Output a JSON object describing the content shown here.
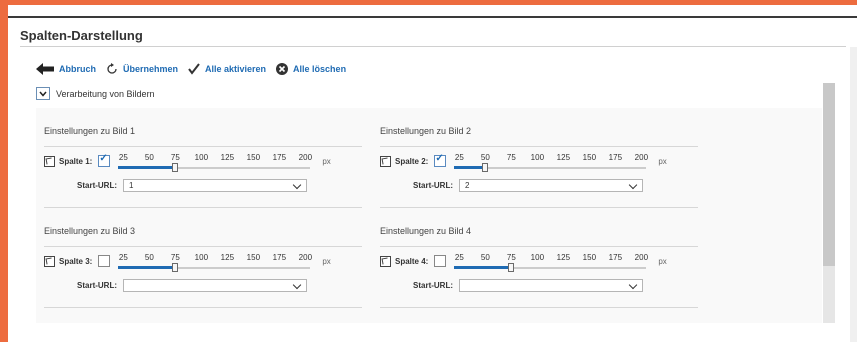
{
  "title": "Spalten-Darstellung",
  "toolbar": {
    "cancel": "Abbruch",
    "apply": "Übernehmen",
    "activate_all": "Alle aktivieren",
    "delete_all": "Alle löschen"
  },
  "section": {
    "label": "Verarbeitung von Bildern"
  },
  "slider_ticks": [
    "25",
    "50",
    "75",
    "100",
    "125",
    "150",
    "175",
    "200"
  ],
  "unit": "px",
  "url_label": "Start-URL:",
  "cards": [
    {
      "title": "Einstellungen zu Bild 1",
      "column_label": "Spalte 1:",
      "checked": true,
      "value": 75,
      "url": "1"
    },
    {
      "title": "Einstellungen zu Bild 2",
      "column_label": "Spalte 2:",
      "checked": true,
      "value": 50,
      "url": "2"
    },
    {
      "title": "Einstellungen zu Bild 3",
      "column_label": "Spalte 3:",
      "checked": false,
      "value": 75,
      "url": ""
    },
    {
      "title": "Einstellungen zu Bild 4",
      "column_label": "Spalte 4:",
      "checked": false,
      "value": 75,
      "url": ""
    }
  ],
  "colors": {
    "accent": "#ed6c3f",
    "link": "#1f6bb3"
  }
}
